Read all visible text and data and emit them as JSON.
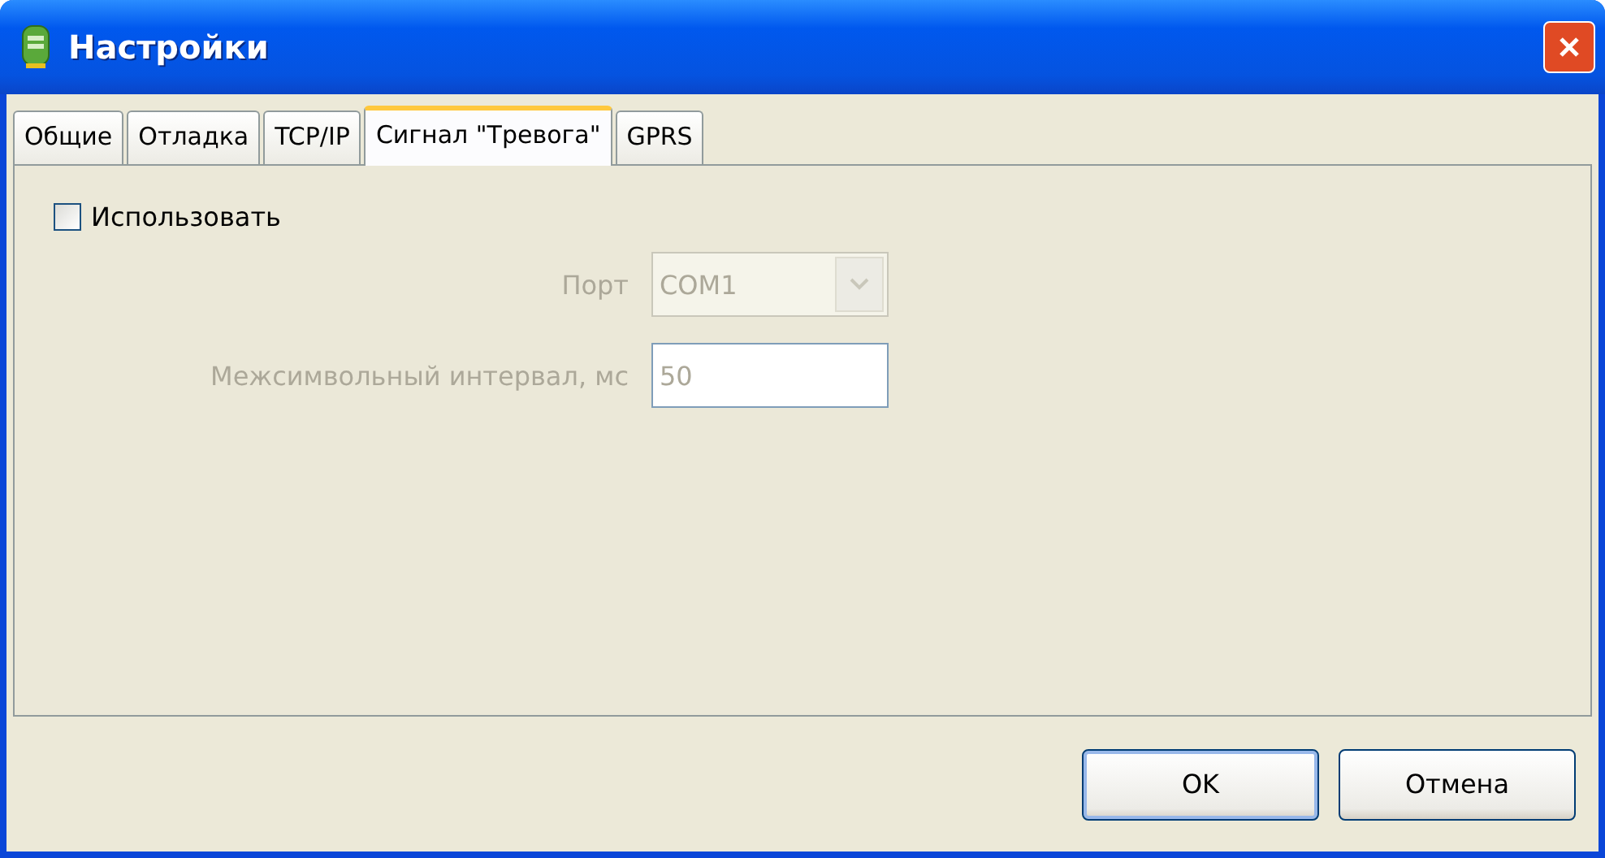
{
  "window": {
    "title": "Настройки"
  },
  "tabs": [
    {
      "label": "Общие",
      "selected": false
    },
    {
      "label": "Отладка",
      "selected": false
    },
    {
      "label": "TCP/IP",
      "selected": false
    },
    {
      "label": "Сигнал \"Тревога\"",
      "selected": true
    },
    {
      "label": "GPRS",
      "selected": false
    }
  ],
  "use_checkbox": {
    "label": "Использовать",
    "checked": false
  },
  "fields": [
    {
      "kind": "dropdown",
      "label": "Порт",
      "value": "COM1",
      "disabled": true
    },
    {
      "kind": "text",
      "label": "Межсимвольный интервал, мс",
      "value": "50",
      "disabled": true
    }
  ],
  "buttons": [
    {
      "label": "OK",
      "default": true
    },
    {
      "label": "Отмена",
      "default": false
    }
  ]
}
